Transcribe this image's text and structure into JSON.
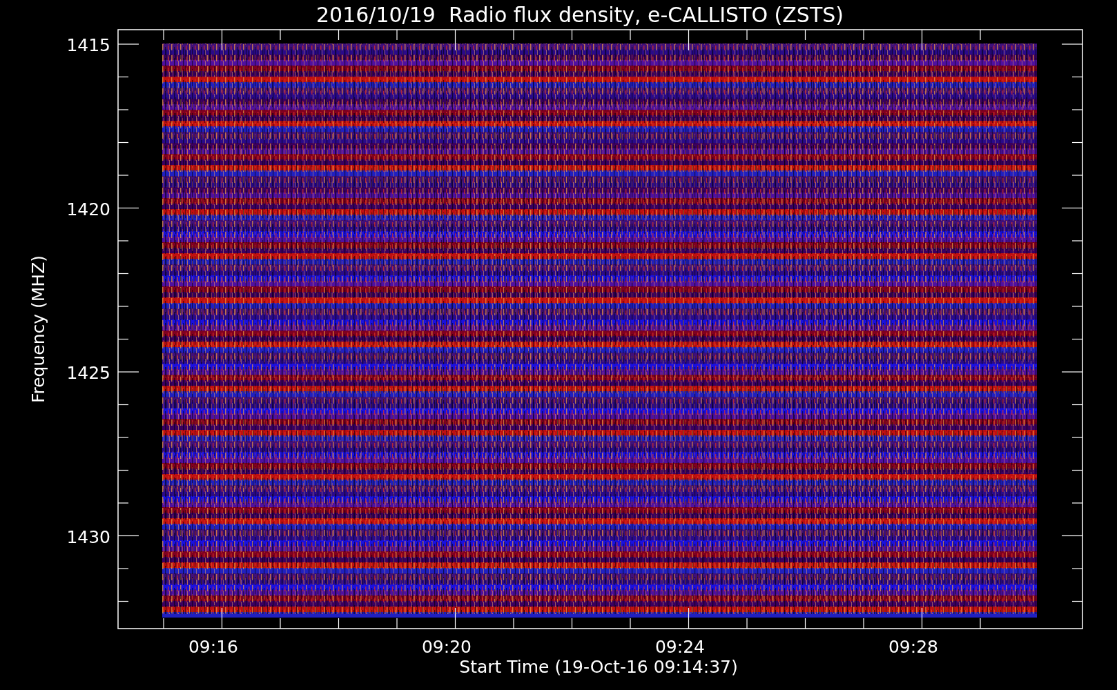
{
  "title": "2016/10/19  Radio flux density, e-CALLISTO (ZSTS)",
  "y_axis": {
    "label": "Frequency (MHZ)",
    "ticks": [
      "1415",
      "1420",
      "1425",
      "1430"
    ]
  },
  "x_axis": {
    "label": "Start Time (19-Oct-16 09:14:37)",
    "ticks": [
      "09:16",
      "09:20",
      "09:24",
      "09:28"
    ]
  }
}
